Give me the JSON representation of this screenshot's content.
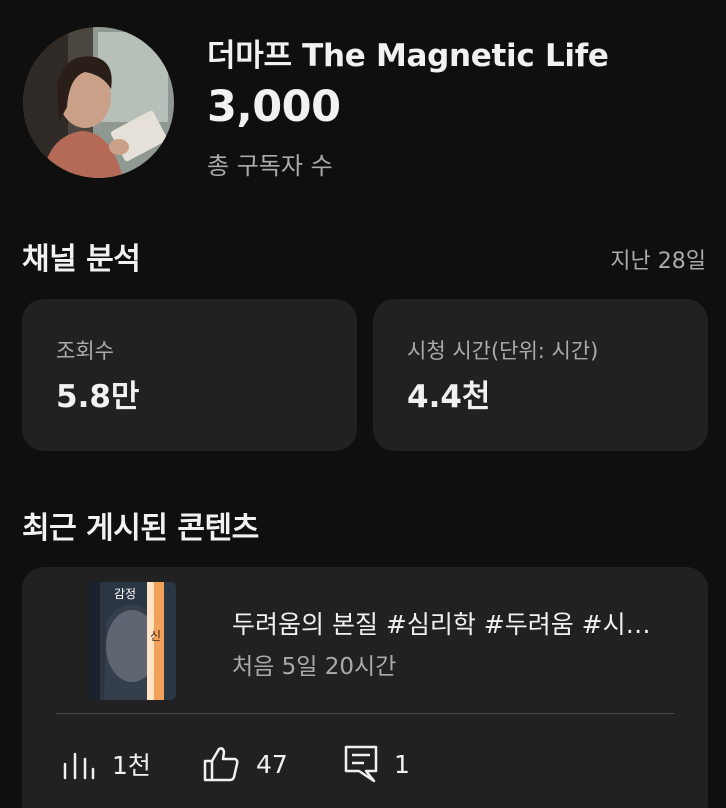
{
  "channel": {
    "name": "더마프 The Magnetic Life",
    "subscribers": "3,000",
    "subscribers_label": "총 구독자 수"
  },
  "analytics": {
    "title": "채널 분석",
    "period": "지난 28일",
    "cards": [
      {
        "label": "조회수",
        "value": "5.8만"
      },
      {
        "label": "시청 시간(단위: 시간)",
        "value": "4.4천"
      }
    ]
  },
  "recent": {
    "title": "최근 게시된 콘텐츠",
    "item": {
      "thumbnail_text": "감정",
      "thumbnail_text_2": "신",
      "title": "두려움의 본질 #심리학 #두려움 #시…",
      "meta": "처음 5일 20시간",
      "views": "1천",
      "likes": "47",
      "comments": "1"
    }
  },
  "icons": {
    "views": "bar-chart-icon",
    "likes": "thumbs-up-icon",
    "comments": "comment-icon"
  }
}
